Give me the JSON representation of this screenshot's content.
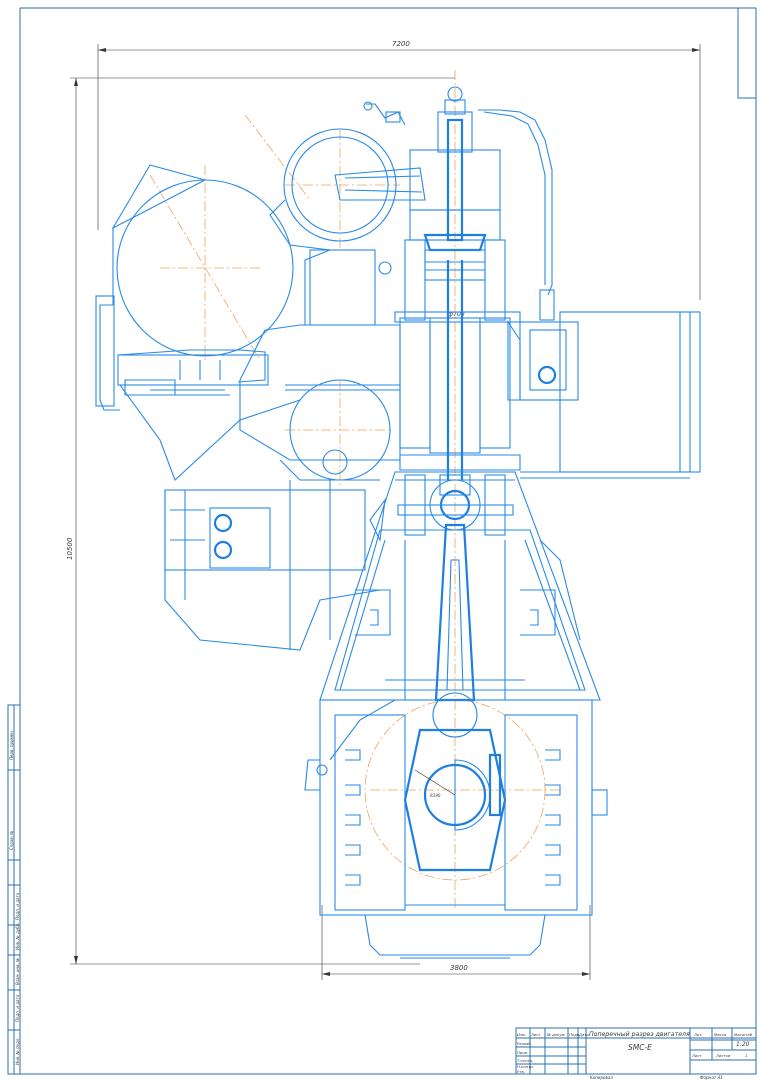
{
  "drawing": {
    "title_line1": "Поперечный разрез двигателя",
    "title_line2": "SMC-E",
    "dimensions": {
      "overall_width": "7200",
      "overall_height": "10500",
      "base_width": "3800",
      "cylinder_bore": "ф700",
      "crank_radius": "R390"
    }
  },
  "title_block": {
    "row_headers": [
      "Изм.",
      "Лист",
      "№ докум.",
      "Подп.",
      "Дата"
    ],
    "roles": [
      "Разраб.",
      "Пров.",
      "Т.контр.",
      "Н.контр.",
      "Утв."
    ],
    "lit_label": "Лит.",
    "mass_label": "Масса",
    "scale_label": "Масштаб",
    "scale_value": "1:20",
    "sheet_label": "Лист",
    "sheets_label": "Листов",
    "sheets_value": "1",
    "copied": "Копировал",
    "format": "Формат   А1"
  },
  "side_stamp": [
    "Подп. и дата",
    "Инв. № дубл.",
    "Взам. инв. №",
    "Подп. и дата",
    "Инв. № подл.",
    "Справ. №",
    "Перв. примен."
  ],
  "colors": {
    "line": "#2a8ae6",
    "axis": "#f0a35a",
    "hatch": "#c04a4a",
    "frame": "#2f6fb2"
  }
}
